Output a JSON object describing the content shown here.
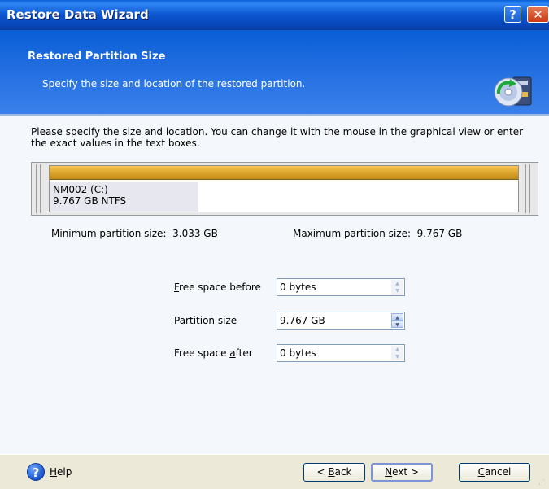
{
  "window": {
    "title": "Restore Data Wizard",
    "help_glyph": "?",
    "close_glyph": "✕"
  },
  "header": {
    "title": "Restored Partition Size",
    "subtitle": "Specify the size and location of the restored partition.",
    "icon": "restore-disk-icon"
  },
  "intro": "Please specify the size and location. You can change it with the mouse in the graphical view or enter the exact values in the text boxes.",
  "partition": {
    "name": "NM002 (C:)",
    "details": "9.767 GB  NTFS",
    "bar_color": "#d8a026",
    "used_fraction": 0.31
  },
  "limits": {
    "min_label": "Minimum partition size:",
    "min_value": "3.033 GB",
    "max_label": "Maximum partition size:",
    "max_value": "9.767 GB"
  },
  "fields": {
    "free_before": {
      "label_key": "F",
      "label_rest": "ree space before",
      "value": "0 bytes"
    },
    "partition_size": {
      "label_key": "P",
      "label_rest": "artition size",
      "value": "9.767 GB"
    },
    "free_after_prefix": "Free space ",
    "free_after_key": "a",
    "free_after_rest": "fter",
    "free_after_value": "0 bytes"
  },
  "footer": {
    "help_key": "H",
    "help_rest": "elp",
    "back_prefix": "< ",
    "back_key": "B",
    "back_rest": "ack",
    "next_key": "N",
    "next_rest": "ext >",
    "cancel_key": "C",
    "cancel_rest": "ancel"
  }
}
